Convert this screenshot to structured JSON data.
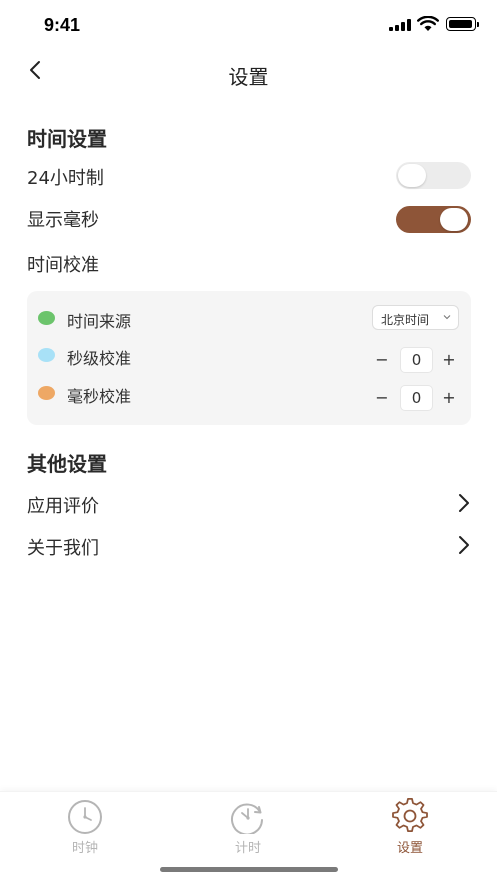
{
  "status_bar": {
    "time": "9:41"
  },
  "nav": {
    "back_icon": "chevron-left-icon",
    "title": "设置"
  },
  "time_settings": {
    "section_title": "时间设置",
    "hour24": {
      "label": "24小时制",
      "enabled": false
    },
    "show_ms": {
      "label": "显示毫秒",
      "enabled": true
    },
    "calibration_label": "时间校准"
  },
  "calibration": {
    "source": {
      "label": "时间来源",
      "dot_color": "#6cc46c",
      "selected": "北京时间"
    },
    "seconds": {
      "label": "秒级校准",
      "dot_color": "#a8e1f7",
      "value": "0",
      "minus": "−",
      "plus": "+"
    },
    "millis": {
      "label": "毫秒校准",
      "dot_color": "#eea865",
      "value": "0",
      "minus": "−",
      "plus": "+"
    }
  },
  "other_settings": {
    "section_title": "其他设置",
    "items": [
      {
        "label": "应用评价",
        "icon": "chevron-right-icon"
      },
      {
        "label": "关于我们",
        "icon": "chevron-right-icon"
      }
    ]
  },
  "tab_bar": {
    "tabs": [
      {
        "label": "时钟",
        "icon": "clock-icon",
        "active": false
      },
      {
        "label": "计时",
        "icon": "stopwatch-icon",
        "active": false
      },
      {
        "label": "设置",
        "icon": "gear-icon",
        "active": true
      }
    ],
    "active_color": "#8e5538",
    "inactive_color": "#b5b5b5"
  },
  "colors": {
    "accent": "#8e5538",
    "toggle_off": "#ececec",
    "card_bg": "#f5f5f5"
  }
}
